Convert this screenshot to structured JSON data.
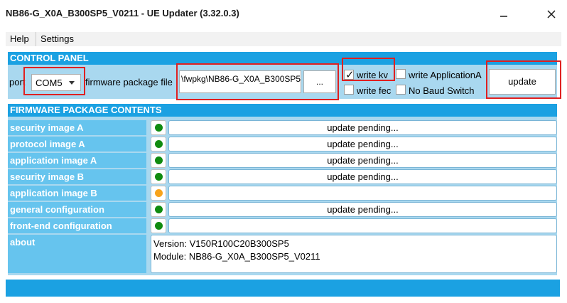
{
  "window": {
    "title": "NB86-G_X0A_B300SP5_V0211 - UE Updater (3.32.0.3)",
    "minimize_icon": "minimize-icon",
    "close_icon": "close-icon"
  },
  "menu": {
    "help": "Help",
    "settings": "Settings"
  },
  "control_panel": {
    "header": "CONTROL PANEL",
    "port_label": "port",
    "port_value": "COM5",
    "firmware_label": "firmware package file",
    "firmware_value": "\\fwpkg\\NB86-G_X0A_B300SP5",
    "browse_label": "...",
    "write_kv_label": "write kv",
    "write_kv_checked": true,
    "write_app_label": "write ApplicationA",
    "write_app_checked": false,
    "write_fec_label": "write fec",
    "write_fec_checked": false,
    "no_baud_label": "No Baud Switch",
    "no_baud_checked": false,
    "update_label": "update"
  },
  "contents": {
    "header": "FIRMWARE PACKAGE CONTENTS",
    "rows": [
      {
        "label": "security image A",
        "status": "update pending...",
        "color": "#108b10"
      },
      {
        "label": "protocol image A",
        "status": "update pending...",
        "color": "#108b10"
      },
      {
        "label": "application image A",
        "status": "update pending...",
        "color": "#108b10"
      },
      {
        "label": "security image B",
        "status": "update pending...",
        "color": "#108b10"
      },
      {
        "label": "application image B",
        "status": "",
        "color": "#f7a31c"
      },
      {
        "label": "general configuration",
        "status": "update pending...",
        "color": "#108b10"
      },
      {
        "label": "front-end configuration",
        "status": "",
        "color": "#108b10"
      }
    ],
    "about": {
      "label": "about",
      "version": "Version: V150R100C20B300SP5",
      "module": "Module: NB86-G_X0A_B300SP5_V0211"
    }
  },
  "colors": {
    "accent": "#1ba1e2",
    "panel": "#a9d8ef",
    "row_label": "#66c4ee",
    "highlight": "#e02020"
  }
}
